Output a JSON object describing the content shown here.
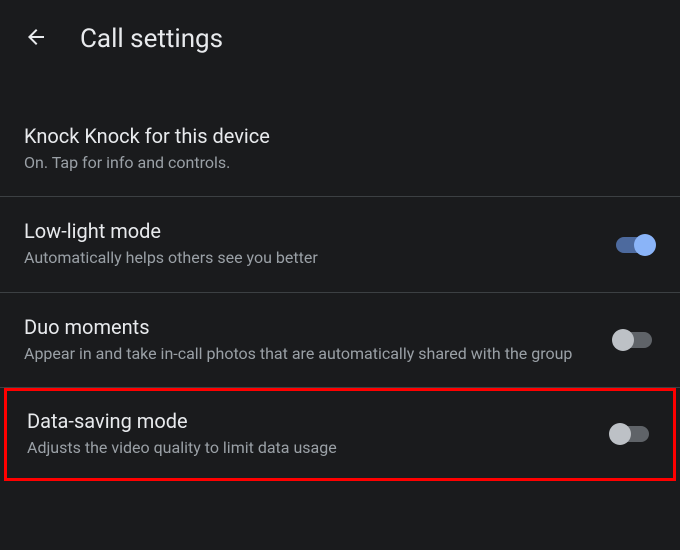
{
  "header": {
    "title": "Call settings"
  },
  "settings": {
    "knock_knock": {
      "title": "Knock Knock for this device",
      "subtitle": "On. Tap for info and controls."
    },
    "low_light": {
      "title": "Low-light mode",
      "subtitle": "Automatically helps others see you better",
      "enabled": true
    },
    "duo_moments": {
      "title": "Duo moments",
      "subtitle": "Appear in and take in-call photos that are automatically shared with the group",
      "enabled": false
    },
    "data_saving": {
      "title": "Data-saving mode",
      "subtitle": "Adjusts the video quality to limit data usage",
      "enabled": false
    }
  }
}
